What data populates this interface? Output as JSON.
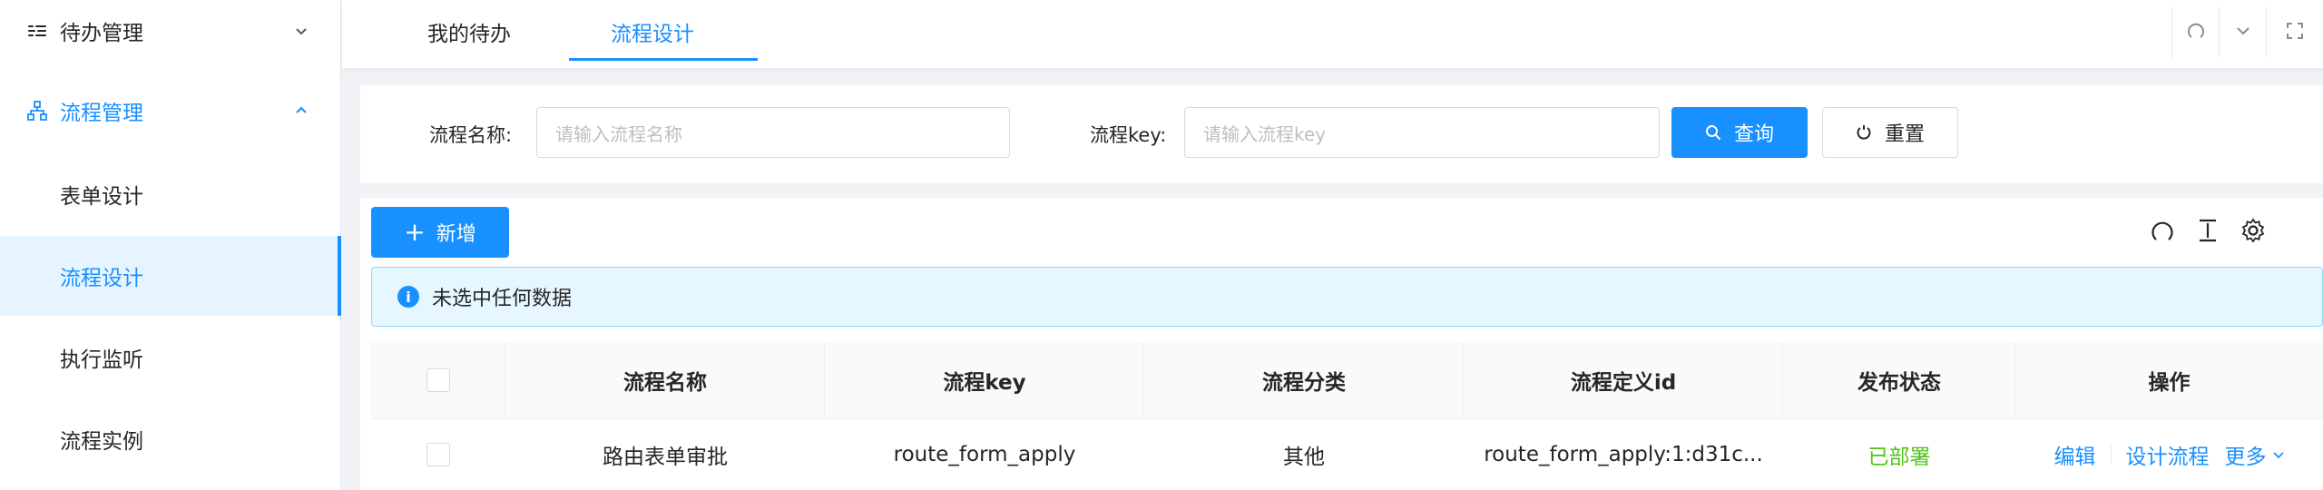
{
  "sidebar": {
    "items": [
      {
        "label": "待办管理",
        "icon": "todo-list-icon",
        "arrow": "chevron-down-icon"
      },
      {
        "label": "流程管理",
        "icon": "workflow-icon",
        "arrow": "chevron-up-icon"
      },
      {
        "label": "表单设计"
      },
      {
        "label": "流程设计"
      },
      {
        "label": "执行监听"
      },
      {
        "label": "流程实例"
      }
    ]
  },
  "tabs": [
    {
      "label": "我的待办"
    },
    {
      "label": "流程设计"
    }
  ],
  "topbar_icons": [
    "refresh-icon",
    "chevron-down-icon",
    "fullscreen-icon"
  ],
  "search": {
    "name_label": "流程名称:",
    "name_placeholder": "请输入流程名称",
    "key_label": "流程key:",
    "key_placeholder": "请输入流程key",
    "query_label": "查询",
    "reset_label": "重置"
  },
  "toolbar": {
    "add_label": "新增",
    "icons": [
      "refresh-icon",
      "column-height-icon",
      "settings-icon"
    ]
  },
  "alert": {
    "text": "未选中任何数据"
  },
  "table": {
    "columns": [
      "流程名称",
      "流程key",
      "流程分类",
      "流程定义id",
      "发布状态",
      "操作"
    ],
    "rows": [
      {
        "name": "路由表单审批",
        "key": "route_form_apply",
        "category": "其他",
        "definition_id": "route_form_apply:1:d31c...",
        "status": "已部署",
        "actions": {
          "edit": "编辑",
          "design": "设计流程",
          "more": "更多"
        }
      }
    ]
  },
  "colors": {
    "primary": "#1890ff",
    "success": "#52c41a",
    "active_menu_bg": "#e6f4ff",
    "alert_bg": "#e6f7ff"
  }
}
